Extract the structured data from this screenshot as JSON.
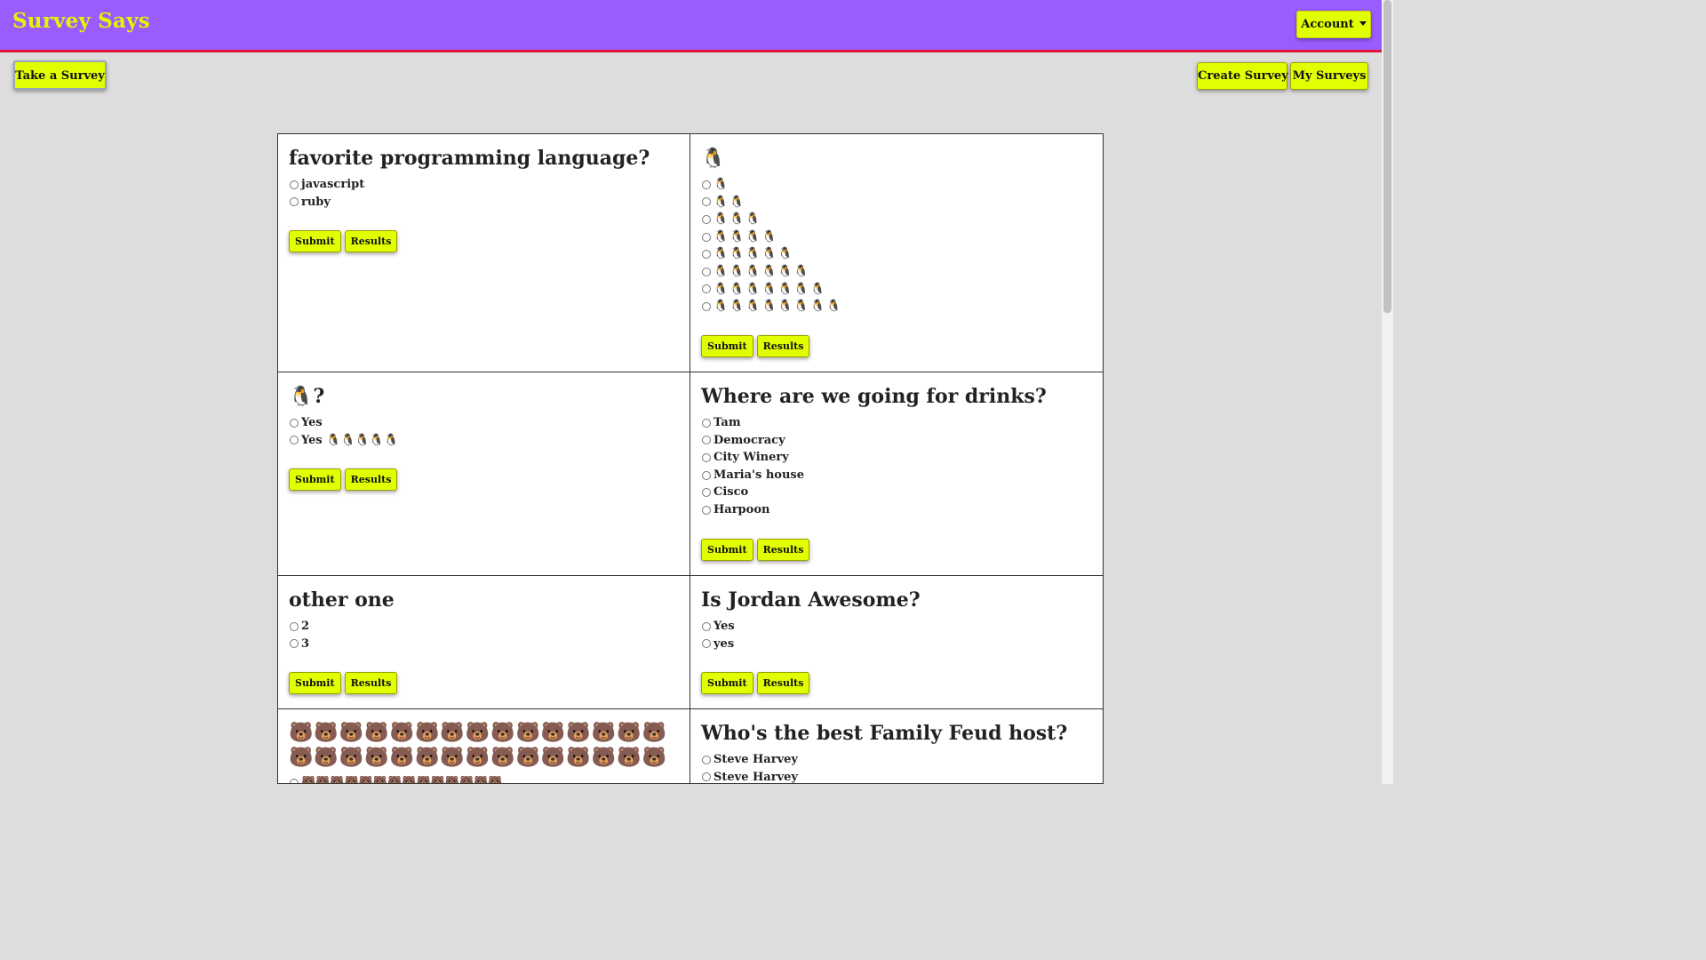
{
  "app": {
    "brand": "Survey Says"
  },
  "header": {
    "account_label": "Account"
  },
  "toolbar": {
    "take_label": "Take a Survey",
    "create_label": "Create Survey",
    "mine_label": "My Surveys"
  },
  "buttons": {
    "submit": "Submit",
    "results": "Results"
  },
  "surveys": [
    {
      "title": "favorite programming language?",
      "options": [
        "javascript",
        "ruby"
      ]
    },
    {
      "title": "🐧",
      "options": [
        "🐧",
        "🐧🐧",
        "🐧🐧🐧",
        "🐧🐧🐧🐧",
        "🐧🐧🐧🐧🐧",
        "🐧🐧🐧🐧🐧🐧",
        "🐧🐧🐧🐧🐧🐧🐧",
        "🐧🐧🐧🐧🐧🐧🐧🐧"
      ]
    },
    {
      "title": "🐧?",
      "options": [
        "Yes",
        "Yes 🐧🐧🐧🐧🐧"
      ]
    },
    {
      "title": "Where are we going for drinks?",
      "options": [
        "Tam",
        "Democracy",
        "City Winery",
        "Maria's house",
        "Cisco",
        "Harpoon"
      ]
    },
    {
      "title": "other one",
      "options": [
        "2",
        "3"
      ]
    },
    {
      "title": "Is Jordan Awesome?",
      "options": [
        "Yes",
        "yes"
      ]
    },
    {
      "title": "🐻🐻🐻🐻🐻🐻🐻🐻🐻🐻🐻🐻🐻🐻🐻🐻🐻🐻🐻🐻🐻🐻🐻🐻🐻🐻🐻🐻🐻🐻",
      "options": [
        "🐻🐻🐻🐻🐻🐻🐻🐻🐻🐻🐻🐻🐻🐻"
      ]
    },
    {
      "title": "Who's the best Family Feud host?",
      "options": [
        "Steve Harvey",
        "Steve Harvey"
      ]
    }
  ],
  "colors": {
    "navbar": "#9b5cff",
    "navbar_border": "#e0143c",
    "brand": "#e4f500",
    "button": "#e1ff00",
    "page": "#dddddd"
  }
}
